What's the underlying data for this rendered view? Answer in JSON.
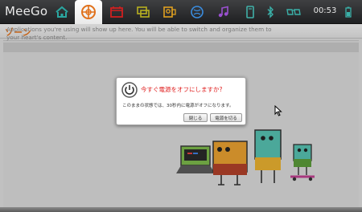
{
  "app": {
    "brand": "MeeGo",
    "clock": "00:53",
    "zone_title": "ゾーン"
  },
  "toolbar": {
    "icons": [
      "home-icon",
      "zones-icon",
      "calendar-icon",
      "status-chat-icon",
      "people-icon",
      "internet-icon",
      "media-icon",
      "devices-icon",
      "bluetooth-icon",
      "network-icon",
      "battery-icon"
    ],
    "active_icon": "zones-icon"
  },
  "main": {
    "info_text": "Applications you're using will show up here. You will be able to switch and organize them to your heart's content."
  },
  "dialog": {
    "title": "今すぐ電源をオフにしますか?",
    "body": "このままの状態では、30秒内に電源がオフになります。",
    "close_button": "閉じる",
    "power_off_button": "電源を切る"
  },
  "colors": {
    "accent": "#e0701a",
    "dialog_title": "#e02020",
    "toolbar_bg": "#2a2b2d"
  }
}
